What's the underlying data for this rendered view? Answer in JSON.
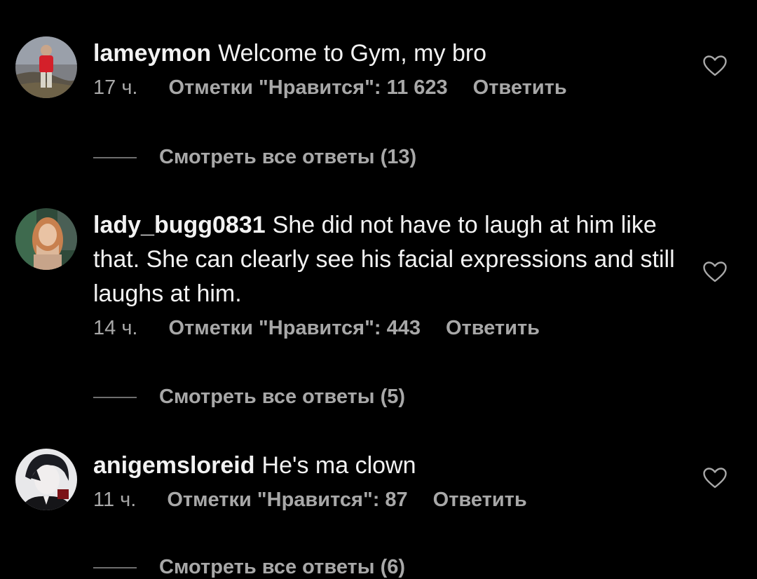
{
  "comments": [
    {
      "username": "lameymon",
      "text": "Welcome to Gym, my bro",
      "time": "17 ч.",
      "likes": "Отметки \"Нравится\": 11 623",
      "reply_label": "Ответить",
      "view_replies": "Смотреть все ответы (13)"
    },
    {
      "username": "lady_bugg0831",
      "text": "She did not have to laugh at him like that. She can clearly see his facial expressions and still laughs at him.",
      "time": "14 ч.",
      "likes": "Отметки \"Нравится\": 443",
      "reply_label": "Ответить",
      "view_replies": "Смотреть все ответы (5)"
    },
    {
      "username": "anigemsloreid",
      "text": "He's ma clown",
      "time": "11 ч.",
      "likes": "Отметки \"Нравится\": 87",
      "reply_label": "Ответить",
      "view_replies": "Смотреть все ответы (6)"
    }
  ],
  "icons": {
    "like": "heart-outline-icon"
  },
  "colors": {
    "background": "#000000",
    "primary_text": "#f2f2f2",
    "secondary_text": "#a8a8a8"
  }
}
